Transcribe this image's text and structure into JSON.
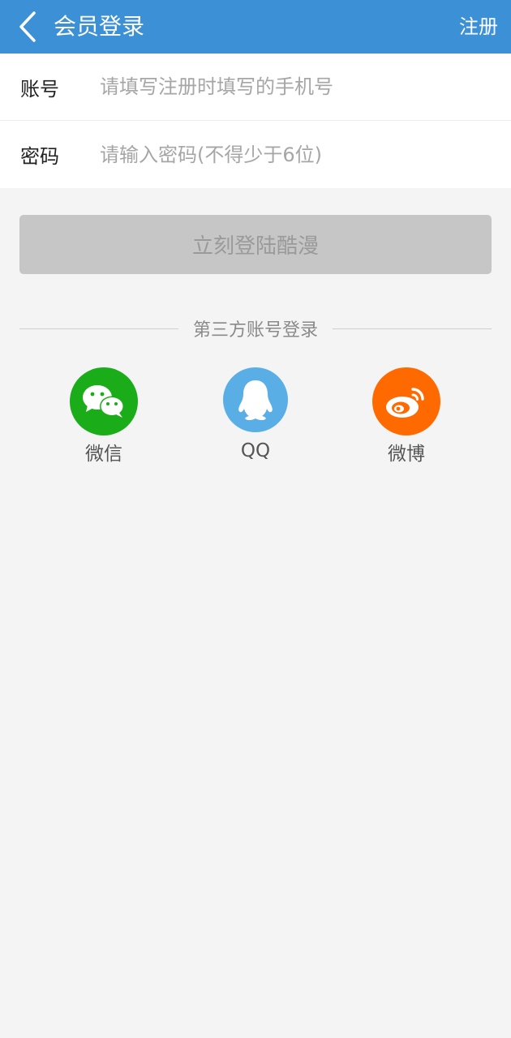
{
  "header": {
    "title": "会员登录",
    "register_label": "注册"
  },
  "form": {
    "account": {
      "label": "账号",
      "placeholder": "请填写注册时填写的手机号",
      "value": ""
    },
    "password": {
      "label": "密码",
      "placeholder": "请输入密码(不得少于6位)",
      "value": ""
    }
  },
  "login_button": "立刻登陆酷漫",
  "third_party": {
    "title": "第三方账号登录",
    "items": [
      {
        "label": "微信",
        "icon": "wechat-icon",
        "color": "#1aad19"
      },
      {
        "label": "QQ",
        "icon": "qq-icon",
        "color": "#5aaee6"
      },
      {
        "label": "微博",
        "icon": "weibo-icon",
        "color": "#ff6a00"
      }
    ]
  },
  "colors": {
    "header": "#3c90d6",
    "background": "#f4f4f4",
    "button_disabled": "#c6c6c6"
  }
}
